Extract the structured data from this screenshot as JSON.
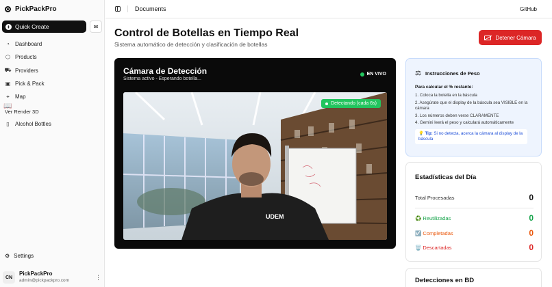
{
  "app": {
    "name": "PickPackPro"
  },
  "sidebar": {
    "quick_create": "Quick Create",
    "items": [
      {
        "label": "Dashboard",
        "icon": "dashboard-icon"
      },
      {
        "label": "Products",
        "icon": "box-icon"
      },
      {
        "label": "Providers",
        "icon": "truck-icon"
      },
      {
        "label": "Pick & Pack",
        "icon": "package-icon"
      },
      {
        "label": "Map",
        "icon": "map-icon"
      },
      {
        "label": "Ver Render 3D",
        "icon": "book-icon"
      },
      {
        "label": "Alcohol Bottles",
        "icon": "bottle-icon"
      }
    ],
    "settings": "Settings",
    "user": {
      "initials": "CN",
      "name": "PickPackPro",
      "email": "admin@pickpackpro.com"
    }
  },
  "topbar": {
    "title": "Documents",
    "github": "GitHub"
  },
  "page": {
    "title": "Control de Botellas en Tiempo Real",
    "subtitle": "Sistema automático de detección y clasificación de botellas",
    "stop_button": "Detener Cámara"
  },
  "camera": {
    "title": "Cámara de Detección",
    "status": "Sistema activo - Esperando botella...",
    "live": "EN VIVO",
    "detecting": "Detectando (cada 6s)",
    "shirt_text": "UDEM"
  },
  "instructions": {
    "title": "Instrucciones de Peso",
    "lead": "Para calcular el % restante:",
    "steps": [
      "1. Coloca la botella en la báscula",
      "2. Asegúrate que el display de la báscula sea VISIBLE en la cámara",
      "3. Los números deben verse CLARAMENTE",
      "4. Gemini leerá el peso y calculará automáticamente"
    ],
    "tip_label": "Tip:",
    "tip_text": "Si no detecta, acerca la cámara al display de la báscula"
  },
  "stats": {
    "title": "Estadísticas del Día",
    "total_label": "Total Procesadas",
    "total_value": "0",
    "rows": [
      {
        "label": "♻️ Reutilizadas",
        "value": "0",
        "color": "#16a34a"
      },
      {
        "label": "☑️ Completadas",
        "value": "0",
        "color": "#ea580c"
      },
      {
        "label": "🗑️ Descartadas",
        "value": "0",
        "color": "#dc2626"
      }
    ]
  },
  "db": {
    "title": "Detecciones en BD"
  },
  "colors": {
    "accent_red": "#dc2626",
    "live_green": "#22c55e",
    "info_bg": "#eef4fe"
  }
}
